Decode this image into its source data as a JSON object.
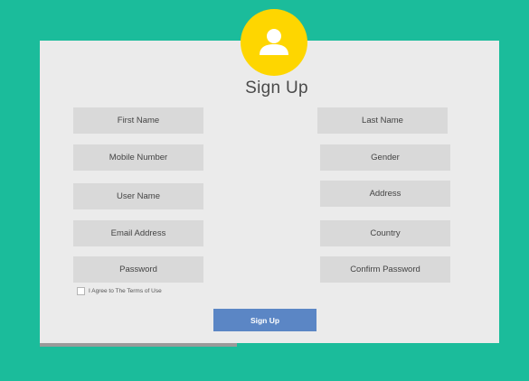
{
  "colors": {
    "background": "#1bbc9b",
    "card": "#ebebeb",
    "avatar": "#fed600",
    "field": "#d9d9d9",
    "button": "#5b86c5"
  },
  "avatar_icon": "user-icon",
  "title": "Sign Up",
  "fields": {
    "first_name": "First Name",
    "last_name": "Last Name",
    "mobile_number": "Mobile Number",
    "gender": "Gender",
    "user_name": "User Name",
    "address": "Address",
    "email_address": "Email Address",
    "country": "Country",
    "password": "Password",
    "confirm_password": "Confirm Password"
  },
  "terms_label": "I Agree to The Terms of Use",
  "submit_label": "Sign Up"
}
